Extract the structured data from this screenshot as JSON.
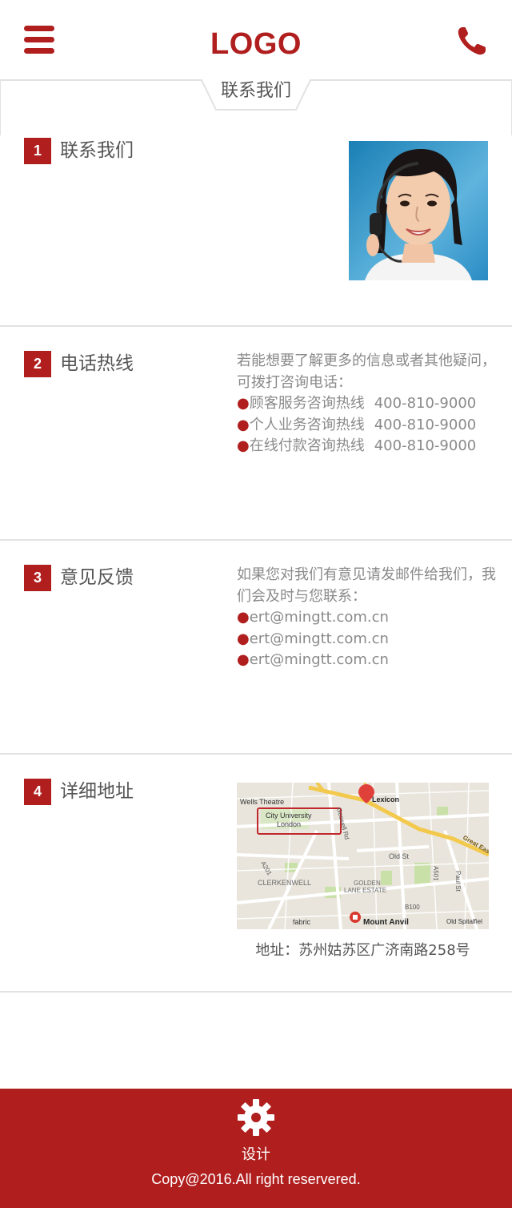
{
  "header": {
    "menu_icon": "hamburger-menu-icon",
    "logo": "LOGO",
    "phone_icon": "phone-icon"
  },
  "banner": {
    "title": "联系我们"
  },
  "sections": [
    {
      "number": "1",
      "title": "联系我们",
      "image": "customer-service-agent-photo"
    },
    {
      "number": "2",
      "title": "电话热线",
      "intro": "若能想要了解更多的信息或者其他疑问，可拨打咨询电话：",
      "lines": [
        {
          "label": "顾客服务咨询热线",
          "phone": "400-810-9000"
        },
        {
          "label": "个人业务咨询热线",
          "phone": "400-810-9000"
        },
        {
          "label": "在线付款咨询热线",
          "phone": "400-810-9000"
        }
      ]
    },
    {
      "number": "3",
      "title": "意见反馈",
      "intro": "如果您对我们有意见请发邮件给我们，我们会及时与您联系：",
      "emails": [
        "ert@mingtt.com.cn",
        "ert@mingtt.com.cn",
        "ert@mingtt.com.cn"
      ]
    },
    {
      "number": "4",
      "title": "详细地址",
      "map": {
        "labels": [
          "Wells Theatre",
          "City University London",
          "Goswell Rd",
          "Lexicon",
          "Old St",
          "A501",
          "Paul St",
          "Great Eastern",
          "A201",
          "CLERKENWELL",
          "GOLDEN LANE ESTATE",
          "fabric",
          "Mount Anvil",
          "B100",
          "Old Spitalfiel"
        ]
      },
      "address": "地址：苏州姑苏区广济南路258号"
    }
  ],
  "footer": {
    "icon": "gear-icon",
    "label": "设计",
    "copyright": "Copy@2016.All right reservered."
  },
  "colors": {
    "brand": "#b01e1e",
    "text": "#555555",
    "muted": "#8a8a8a",
    "divider": "#e2e2e2"
  }
}
